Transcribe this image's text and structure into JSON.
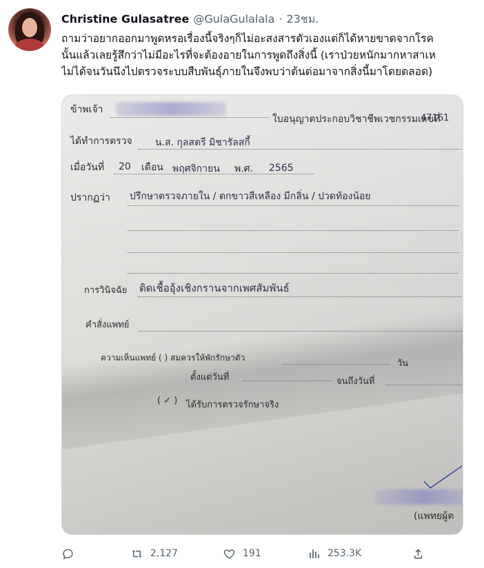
{
  "tweet": {
    "author": {
      "display_name": "Christine Gulasatree",
      "handle": "@GulaGulalala",
      "separator": "·",
      "time": "23ชม."
    },
    "text_lines": [
      "ถามว่าอยากออกมาพูดหรอเรื่องนี้จริงๆก็ไม่อะสงสารตัวเองแต่ก็ได้หายขาดจากโรค",
      "นั้นแล้วเลยรู้สึกว่าไม่มีอะไรที่จะต้องอายในการพูดถึงสิ่งนี้ (เราป่วยหนักมากหาสาเห",
      "ไม่ได้จนวันนึงไปตรวจระบบสืบพันธุ์ภายในจึงพบว่าต้นต่อมาจากสิ่งนี้มาโดยตลอด)"
    ],
    "media": {
      "doc_labels": {
        "i": "ข้าพเจ้า",
        "license": "ใบอนุญาตประกอบวิชาชีพเวชกรรมเลขที่",
        "license_no": "47161",
        "examined": "ได้ทำการตรวจ",
        "patient": "น.ส. กุลสตรี มิชารัลสกี้",
        "date_label": "เมื่อวันที่",
        "day": "20",
        "month_label": "เดือน",
        "month": "พฤศจิกายน",
        "year_label": "พ.ศ.",
        "year": "2565",
        "appear_label": "ปรากฏว่า",
        "appear_value": "ปรึกษาตรวจภายใน / ตกขาวสีเหลือง มีกลิ่น / ปวดท้องน้อย",
        "diagnosis_label": "การวินิจฉัย",
        "diagnosis_value": "ติดเชื้ออุ้งเชิงกรานจากเพศสัมพันธ์",
        "order_label": "คำสั่งแพทย์",
        "opinion_label": "ความเห็นแพทย์ (    ) สมควรให้พักรักษาตัว",
        "days_label": "วัน",
        "from_label": "ตั้งแต่วันที่",
        "to_label": "จนถึงวันที่",
        "received_label": "ได้รับการตรวจรักษาจริง",
        "check_paren": "( ✓ )",
        "signature_label": "(แพทยผู้ต"
      }
    },
    "actions": {
      "reply_count": "",
      "retweet_count": "2,127",
      "like_count": "191",
      "views_count": "253.3K"
    }
  }
}
